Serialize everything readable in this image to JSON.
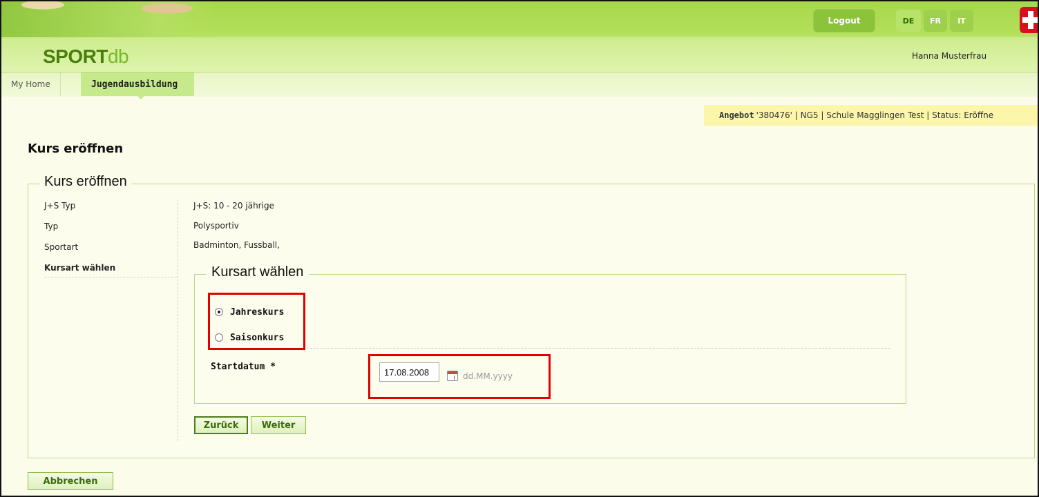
{
  "header": {
    "logo_part1": "SPORT",
    "logo_part2": "db",
    "logout_label": "Logout",
    "languages": [
      "DE",
      "FR",
      "IT"
    ],
    "active_language": "DE",
    "user_name": "Hanna Musterfrau"
  },
  "nav": {
    "items": [
      {
        "label": "My Home"
      },
      {
        "label": "Jugendausbildung"
      }
    ],
    "active": "Jugendausbildung"
  },
  "infobar": {
    "bold_label": "Angebot",
    "text": "'380476' | NG5 | Schule Magglingen Test | Status: Eröffne"
  },
  "page": {
    "title": "Kurs eröffnen",
    "fieldset_legend": "Kurs eröffnen"
  },
  "details": [
    {
      "label": "J+S Typ",
      "value": "J+S: 10 - 20 jährige"
    },
    {
      "label": "Typ",
      "value": "Polysportiv"
    },
    {
      "label": "Sportart",
      "value": "Badminton, Fussball,"
    }
  ],
  "kursart": {
    "label": "Kursart wählen",
    "legend": "Kursart wählen",
    "options": [
      {
        "label": "Jahreskurs",
        "selected": true
      },
      {
        "label": "Saisonkurs",
        "selected": false
      }
    ],
    "start_label": "Startdatum *",
    "start_value": "17.08.2008",
    "date_format": "dd.MM.yyyy"
  },
  "buttons": {
    "back": "Zurück",
    "next": "Weiter",
    "cancel": "Abbrechen"
  },
  "colors": {
    "header_green": "#a6d84a",
    "highlight_red": "#e00000",
    "infobar_yellow": "#fbf6a9"
  }
}
